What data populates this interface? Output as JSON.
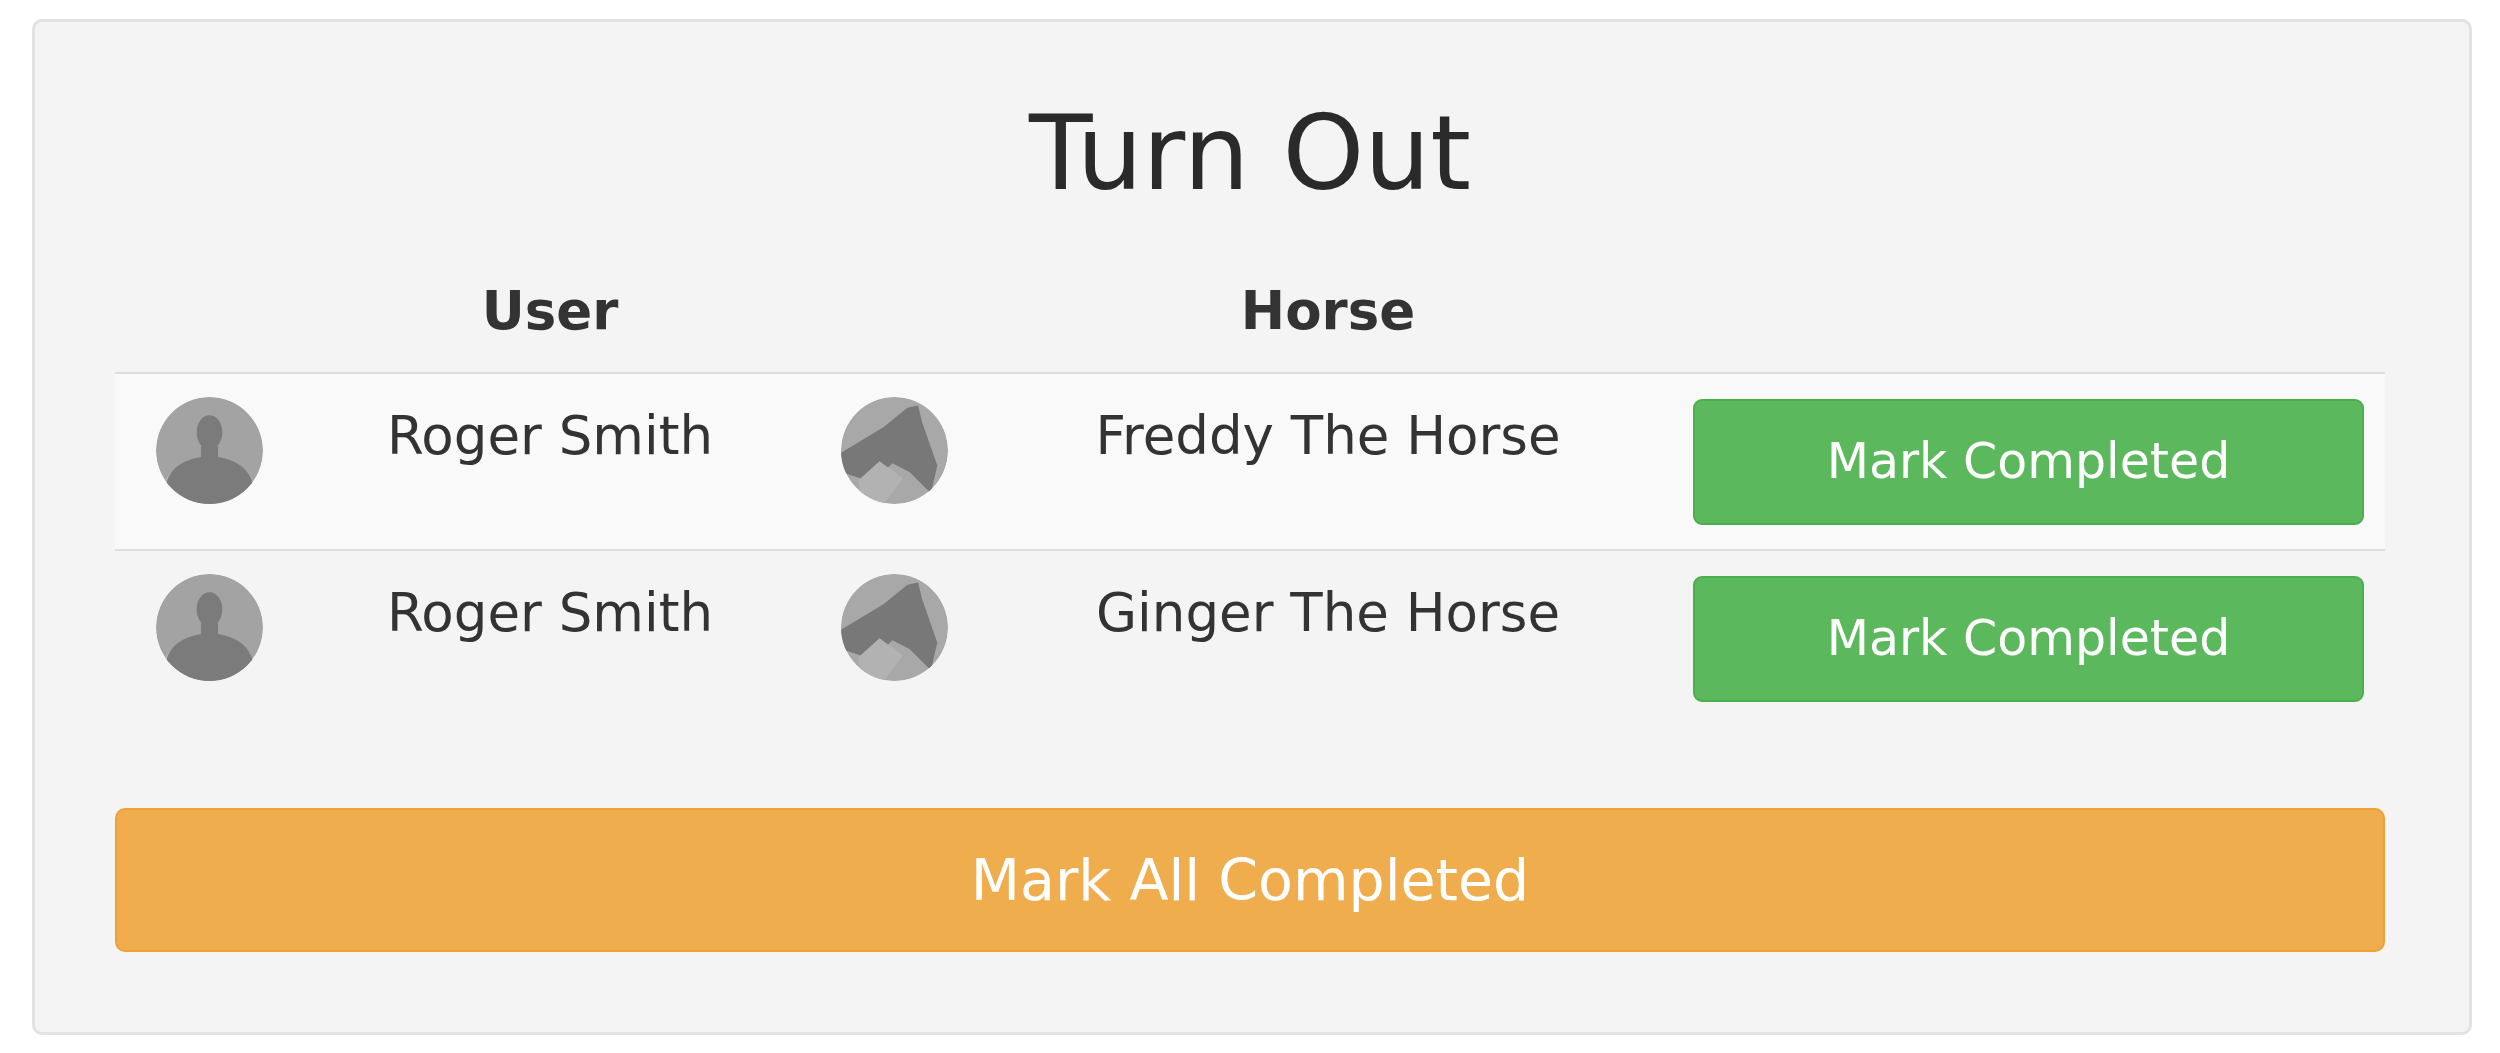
{
  "panel": {
    "title": "Turn Out"
  },
  "table": {
    "header": {
      "user": "User",
      "horse": "Horse"
    },
    "rows": [
      {
        "user": "Roger Smith",
        "horse": "Freddy The Horse",
        "action": "Mark Completed"
      },
      {
        "user": "Roger Smith",
        "horse": "Ginger The Horse",
        "action": "Mark Completed"
      }
    ]
  },
  "footer_button": "Mark All Completed"
}
